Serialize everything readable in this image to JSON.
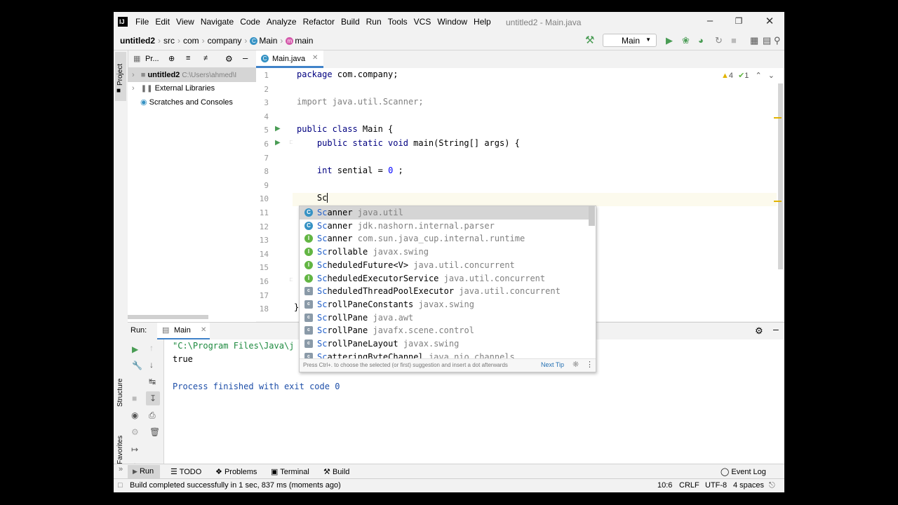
{
  "app": {
    "logo": "IJ",
    "menu": [
      "File",
      "Edit",
      "View",
      "Navigate",
      "Code",
      "Analyze",
      "Refactor",
      "Build",
      "Run",
      "Tools",
      "VCS",
      "Window",
      "Help"
    ],
    "window_title": "untitled2 - Main.java"
  },
  "breadcrumbs": {
    "project": "untitled2",
    "src": "src",
    "com": "com",
    "company": "company",
    "class": "Main",
    "method": "main"
  },
  "toolbar": {
    "run_config": "Main"
  },
  "side_tabs": {
    "project": "Project",
    "structure": "Structure",
    "favorites": "Favorites"
  },
  "project_panel": {
    "title": "Pr...",
    "tree": [
      {
        "label": "untitled2",
        "path": "C:\\Users\\ahmed\\I"
      },
      {
        "label": "External Libraries"
      },
      {
        "label": "Scratches and Consoles"
      }
    ]
  },
  "editor": {
    "tab_label": "Main.java",
    "warnings": "4",
    "checks": "1",
    "line_numbers": [
      "1",
      "2",
      "3",
      "4",
      "5",
      "6",
      "7",
      "8",
      "9",
      "10",
      "11",
      "12",
      "13",
      "14",
      "15",
      "16",
      "17",
      "18"
    ],
    "lines": {
      "l1_kw": "package",
      "l1_rest": " com.company;",
      "l3": "import java.util.Scanner;",
      "l5_kw": "public class",
      "l5_rest": " Main {",
      "l6_kw": "    public static void",
      "l6_rest": " main(String[] args) {",
      "l8_kw": "    int",
      "l8_rest": " sential = ",
      "l8_num": "0",
      "l8_end": " ;",
      "l10": "    Sc",
      "l18": "}"
    }
  },
  "completion": {
    "items": [
      {
        "icon": "C",
        "kind": "class",
        "name_hl": "Sc",
        "name": "anner",
        "tail": " java.util"
      },
      {
        "icon": "C",
        "kind": "class",
        "name_hl": "Sc",
        "name": "anner",
        "tail": " jdk.nashorn.internal.parser"
      },
      {
        "icon": "I",
        "kind": "interface",
        "name_hl": "Sc",
        "name": "anner",
        "tail": " com.sun.java_cup.internal.runtime"
      },
      {
        "icon": "I",
        "kind": "interface",
        "name_hl": "Sc",
        "name": "rollable",
        "tail": " javax.swing"
      },
      {
        "icon": "I",
        "kind": "interface",
        "name_hl": "Sc",
        "name": "heduledFuture<V>",
        "tail": " java.util.concurrent"
      },
      {
        "icon": "I",
        "kind": "interface",
        "name_hl": "Sc",
        "name": "heduledExecutorService",
        "tail": " java.util.concurrent"
      },
      {
        "icon": "c",
        "kind": "compiled",
        "name_hl": "Sc",
        "name": "heduledThreadPoolExecutor",
        "tail": " java.util.concurrent"
      },
      {
        "icon": "c",
        "kind": "compiled",
        "name_hl": "Sc",
        "name": "rollPaneConstants",
        "tail": " javax.swing"
      },
      {
        "icon": "c",
        "kind": "compiled",
        "name_hl": "Sc",
        "name": "rollPane",
        "tail": " java.awt"
      },
      {
        "icon": "c",
        "kind": "compiled",
        "name_hl": "Sc",
        "name": "rollPane",
        "tail": " javafx.scene.control"
      },
      {
        "icon": "c",
        "kind": "compiled",
        "name_hl": "Sc",
        "name": "rollPaneLayout",
        "tail": " javax.swing"
      },
      {
        "icon": "c",
        "kind": "compiled",
        "name_hl": "Sc",
        "name": "atteringByteChannel",
        "tail": " java.nio.channels"
      }
    ],
    "footer_hint": "Press Ctrl+. to choose the selected (or first) suggestion and insert a dot afterwards",
    "next_tip": "Next Tip"
  },
  "run_panel": {
    "label": "Run:",
    "tab": "Main",
    "console": {
      "cmd": "\"C:\\Program Files\\Java\\j",
      "out": "true",
      "finish": "Process finished with exit code 0"
    }
  },
  "bottom_tools": [
    "Run",
    "TODO",
    "Problems",
    "Terminal",
    "Build"
  ],
  "event_log": "Event Log",
  "status_bar": {
    "message": "Build completed successfully in 1 sec, 837 ms (moments ago)",
    "position": "10:6",
    "line_sep": "CRLF",
    "encoding": "UTF-8",
    "indent": "4 spaces"
  },
  "colors": {
    "accent": "#4083c9",
    "run_green": "#499c54",
    "class_icon": "#3592c4",
    "interface_icon": "#62b543",
    "method_icon": "#d55aab",
    "warning": "#e2b400"
  }
}
